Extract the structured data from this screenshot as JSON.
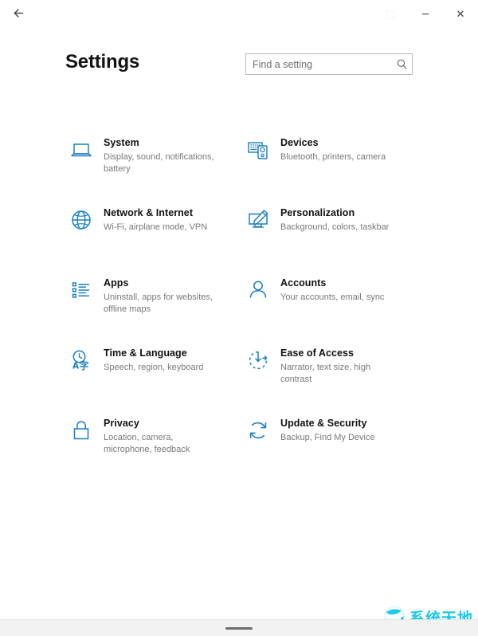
{
  "window": {
    "back_label": "Back",
    "back_icon": "arrow-left-icon",
    "maximize_glyph": "□",
    "minimize_glyph": "─",
    "close_glyph": "✕"
  },
  "header": {
    "title": "Settings",
    "search": {
      "value": "",
      "placeholder": "Find a setting",
      "icon": "search-icon"
    }
  },
  "grid": {
    "tiles": [
      {
        "id": "system",
        "icon": "laptop-icon",
        "title": "System",
        "subtitle": "Display, sound, notifications, battery"
      },
      {
        "id": "devices",
        "icon": "devices-icon",
        "title": "Devices",
        "subtitle": "Bluetooth, printers, camera"
      },
      {
        "id": "network",
        "icon": "globe-icon",
        "title": "Network & Internet",
        "subtitle": "Wi-Fi, airplane mode, VPN"
      },
      {
        "id": "personalization",
        "icon": "monitor-brush-icon",
        "title": "Personalization",
        "subtitle": "Background, colors, taskbar"
      },
      {
        "id": "apps",
        "icon": "list-icon",
        "title": "Apps",
        "subtitle": "Uninstall, apps for websites, offline maps"
      },
      {
        "id": "accounts",
        "icon": "person-icon",
        "title": "Accounts",
        "subtitle": "Your accounts, email, sync"
      },
      {
        "id": "time-language",
        "icon": "clock-language-icon",
        "title": "Time & Language",
        "subtitle": "Speech, region, keyboard"
      },
      {
        "id": "ease-of-access",
        "icon": "ease-of-access-icon",
        "title": "Ease of Access",
        "subtitle": "Narrator, text size, high contrast"
      },
      {
        "id": "privacy",
        "icon": "lock-icon",
        "title": "Privacy",
        "subtitle": "Location, camera, microphone, feedback"
      },
      {
        "id": "update-security",
        "icon": "sync-icon",
        "title": "Update & Security",
        "subtitle": "Backup, Find My Device"
      }
    ]
  },
  "watermark": {
    "text": "系统天地",
    "icon": "globe-logo-icon"
  },
  "colors": {
    "icon_blue": "#1a7fc4",
    "title_text": "#111111",
    "sub_text": "#797979",
    "border": "#b9b9b9",
    "watermark": "#18c7e8"
  }
}
